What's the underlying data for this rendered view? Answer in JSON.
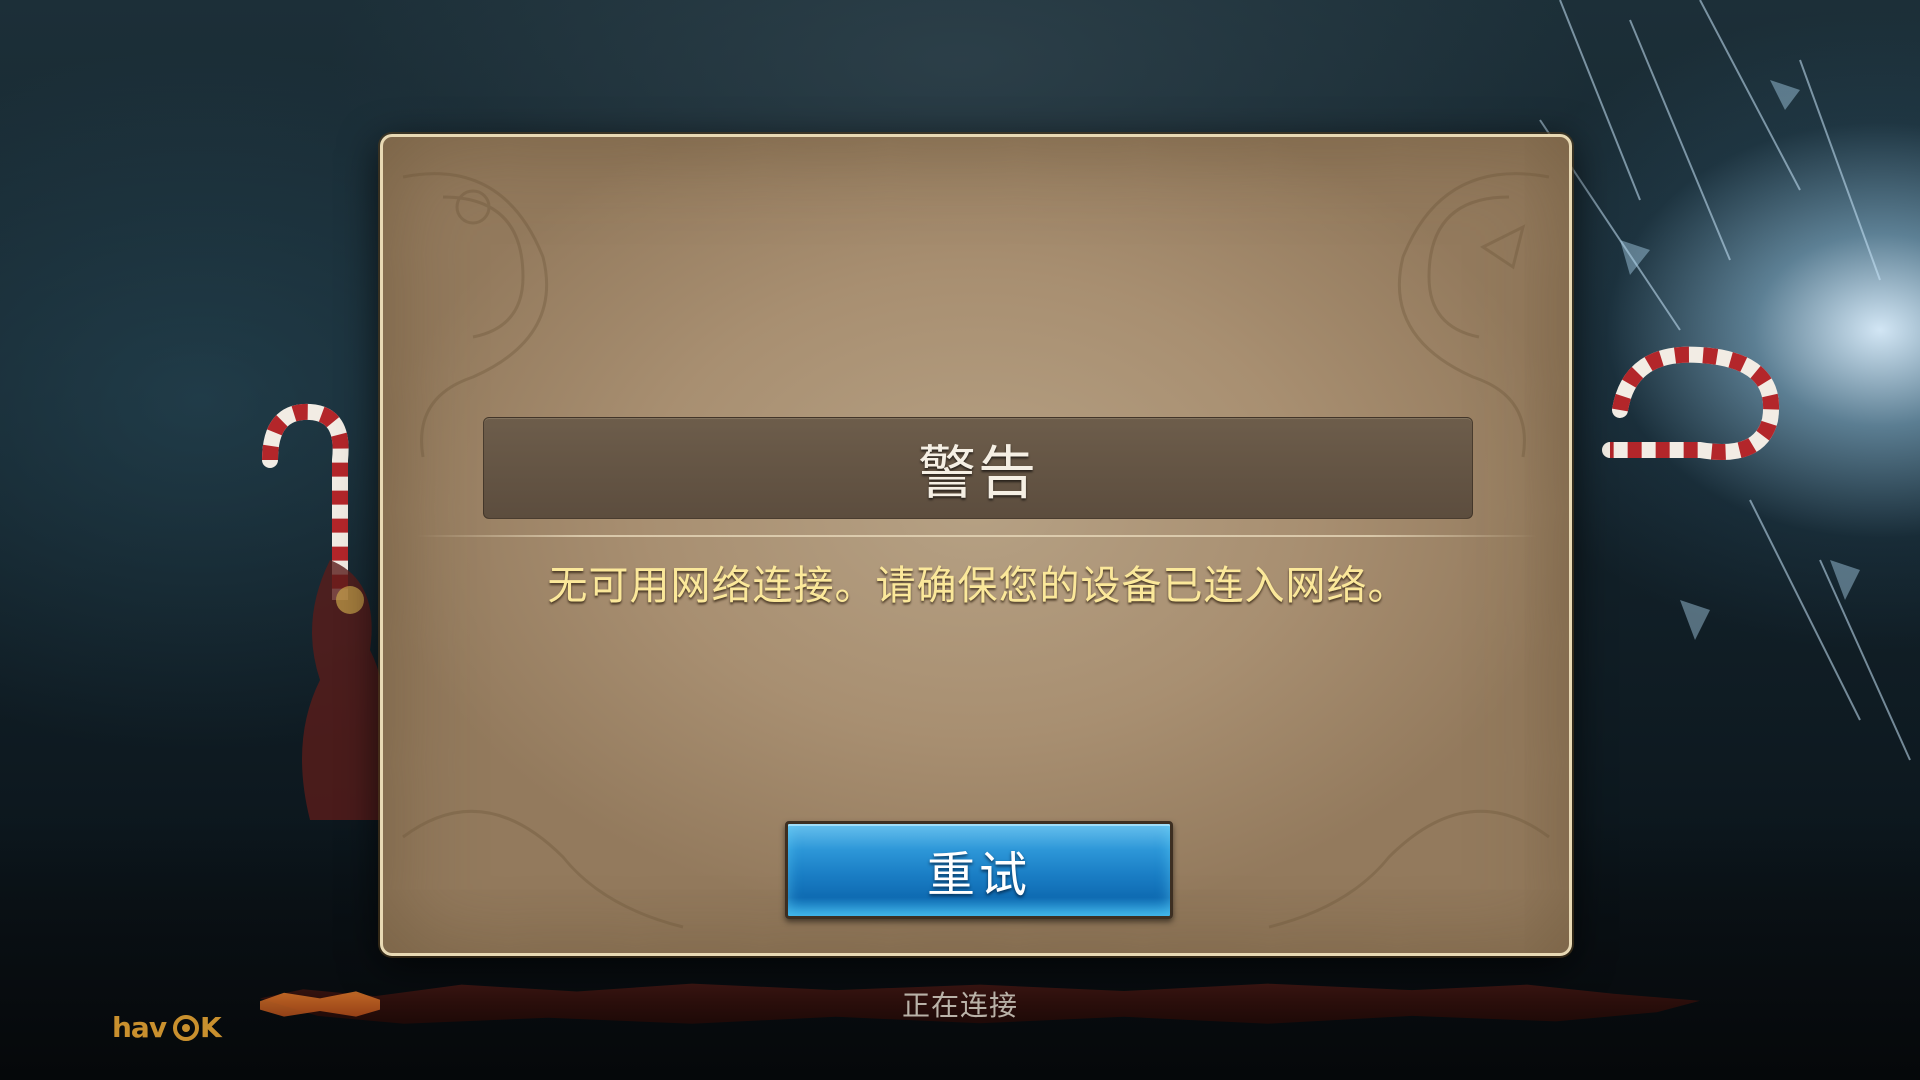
{
  "dialog": {
    "title": "警告",
    "message": "无可用网络连接。请确保您的设备已连入网络。",
    "retry_label": "重试"
  },
  "loading": {
    "status_text": "正在连接"
  },
  "branding": {
    "logo_text": "havok"
  },
  "colors": {
    "message_text": "#fbe89a",
    "title_text": "#f5efe4",
    "button_blue": "#1a7ec5",
    "panel_parchment": "#a88f71"
  }
}
